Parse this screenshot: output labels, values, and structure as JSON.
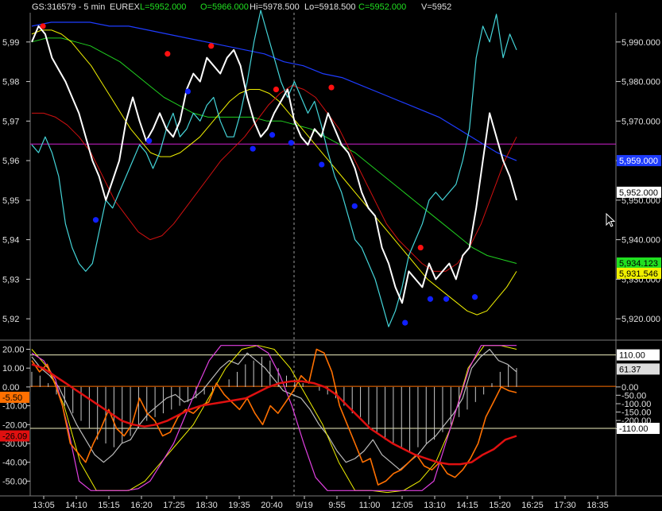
{
  "header": {
    "symbol": "GS:316579 - 5 min",
    "exchange": "EUREX",
    "last": "L=5952.000",
    "open": "O=5966.000",
    "high": "Hi=5978.500",
    "low": "Lo=5918.500",
    "close": "C=5952.000",
    "volume": "V=5952"
  },
  "colors": {
    "price": "#ffffff",
    "cyan": "#44d4d8",
    "yellow": "#f0f000",
    "green": "#20d020",
    "blue": "#1e3cff",
    "darkred": "#d01010",
    "magenta": "#d020d0",
    "orange": "#ff7000",
    "osc_red": "#e01010",
    "grid": "#3a3a3a",
    "axis_text": "#e0e0e0"
  },
  "chart_data": [
    {
      "type": "line",
      "panel": "price",
      "title": "",
      "ylim": [
        5915,
        5997
      ],
      "right_ticks": [
        "5,990.000",
        "5,980.000",
        "5,970.000",
        "5,960.000",
        "5,950.000",
        "5,940.000",
        "5,930.000",
        "5,920.000"
      ],
      "right_tick_values": [
        5990,
        5980,
        5970,
        5960,
        5950,
        5940,
        5930,
        5920
      ],
      "left_ticks": [
        "5,99",
        "5,98",
        "5,97",
        "5,96",
        "5,95",
        "5,94",
        "5,93",
        "5,92"
      ],
      "left_tick_values": [
        5990,
        5980,
        5970,
        5960,
        5950,
        5940,
        5930,
        5920
      ],
      "badges": [
        {
          "text": "5,952.000",
          "value": 5952,
          "bg": "#ffffff",
          "fg": "#000000"
        },
        {
          "text": "5,959.000",
          "value": 5960,
          "bg": "#1e3cff",
          "fg": "#ffffff"
        },
        {
          "text": "5,934.123",
          "value": 5934.1,
          "bg": "#20e020",
          "fg": "#000000"
        },
        {
          "text": "5,931.546",
          "value": 5931.5,
          "bg": "#f0f000",
          "fg": "#000000"
        }
      ],
      "hline": {
        "value": 5964.2,
        "color": "#d020d0"
      },
      "series": [
        {
          "color": "#ffffff",
          "width": 2,
          "values": [
            5990,
            5994,
            5992,
            5986,
            5983,
            5980,
            5976,
            5972,
            5966,
            5960,
            5956,
            5950,
            5955,
            5960,
            5970,
            5976,
            5970,
            5965,
            5968,
            5972,
            5968,
            5966,
            5970,
            5978,
            5982,
            5980,
            5986,
            5984,
            5982,
            5986,
            5988,
            5984,
            5976,
            5970,
            5966,
            5968,
            5972,
            5975,
            5978,
            5970,
            5966,
            5964,
            5968,
            5966,
            5972,
            5968,
            5964,
            5962,
            5958,
            5952,
            5948,
            5946,
            5938,
            5934,
            5928,
            5924,
            5932,
            5930,
            5928,
            5934,
            5930,
            5932,
            5934,
            5930,
            5936,
            5938,
            5948,
            5960,
            5972,
            5966,
            5960,
            5956,
            5950
          ]
        },
        {
          "color": "#44d4d8",
          "width": 1.2,
          "values": [
            5964,
            5962,
            5966,
            5962,
            5956,
            5944,
            5938,
            5934,
            5932,
            5934,
            5942,
            5950,
            5948,
            5952,
            5956,
            5960,
            5964,
            5962,
            5958,
            5962,
            5968,
            5972,
            5966,
            5968,
            5972,
            5970,
            5974,
            5976,
            5970,
            5966,
            5966,
            5972,
            5980,
            5990,
            5998,
            5992,
            5986,
            5980,
            5976,
            5980,
            5976,
            5972,
            5975,
            5969,
            5962,
            5956,
            5952,
            5946,
            5940,
            5938,
            5934,
            5930,
            5924,
            5918,
            5922,
            5928,
            5936,
            5940,
            5944,
            5950,
            5952,
            5950,
            5952,
            5954,
            5960,
            5968,
            5986,
            5994,
            5990,
            5997,
            5986,
            5992,
            5988
          ]
        },
        {
          "color": "#f0f000",
          "width": 1,
          "values": [
            5992,
            5993,
            5993,
            5992,
            5990,
            5987,
            5984,
            5980,
            5976,
            5972,
            5968,
            5965,
            5962,
            5961,
            5961,
            5962,
            5964,
            5966,
            5969,
            5972,
            5975,
            5977,
            5978,
            5978,
            5977,
            5975,
            5972,
            5969,
            5966,
            5963,
            5960,
            5957,
            5954,
            5951,
            5948,
            5945,
            5942,
            5939,
            5936,
            5933,
            5930,
            5928,
            5926,
            5924,
            5922,
            5921,
            5922,
            5925,
            5928,
            5932
          ]
        },
        {
          "color": "#20d020",
          "width": 1,
          "values": [
            5990,
            5991,
            5991,
            5990,
            5989,
            5987,
            5985,
            5982,
            5979,
            5976,
            5974,
            5972,
            5971,
            5971,
            5971,
            5971,
            5970,
            5970,
            5969,
            5968,
            5966,
            5964,
            5962,
            5959,
            5956,
            5953,
            5950,
            5947,
            5944,
            5941,
            5938,
            5936,
            5935,
            5934
          ]
        },
        {
          "color": "#1e3cff",
          "width": 1.2,
          "values": [
            5994,
            5995,
            5995,
            5995,
            5994,
            5994,
            5993,
            5992,
            5991,
            5990,
            5989,
            5988,
            5987,
            5985,
            5984,
            5982,
            5981,
            5979,
            5977,
            5975,
            5973,
            5971,
            5968,
            5965,
            5962,
            5960
          ]
        },
        {
          "color": "#d01010",
          "width": 1,
          "values": [
            5972,
            5972,
            5971,
            5969,
            5966,
            5962,
            5956,
            5950,
            5946,
            5942,
            5940,
            5941,
            5944,
            5948,
            5952,
            5956,
            5960,
            5963,
            5966,
            5970,
            5974,
            5977,
            5979,
            5978,
            5976,
            5972,
            5968,
            5962,
            5956,
            5950,
            5944,
            5940,
            5937,
            5934,
            5932,
            5932,
            5934,
            5938,
            5944,
            5952,
            5960,
            5966
          ]
        }
      ],
      "points": [
        {
          "color": "red",
          "x": 0.023,
          "value": 5994
        },
        {
          "color": "red",
          "x": 0.28,
          "value": 5987
        },
        {
          "color": "red",
          "x": 0.37,
          "value": 5989
        },
        {
          "color": "red",
          "x": 0.504,
          "value": 5978
        },
        {
          "color": "red",
          "x": 0.618,
          "value": 5978.5
        },
        {
          "color": "red",
          "x": 0.802,
          "value": 5938
        },
        {
          "color": "blue",
          "x": 0.132,
          "value": 5945
        },
        {
          "color": "blue",
          "x": 0.242,
          "value": 5965
        },
        {
          "color": "blue",
          "x": 0.322,
          "value": 5977.5
        },
        {
          "color": "blue",
          "x": 0.456,
          "value": 5963
        },
        {
          "color": "blue",
          "x": 0.496,
          "value": 5966.5
        },
        {
          "color": "blue",
          "x": 0.535,
          "value": 5964.5
        },
        {
          "color": "blue",
          "x": 0.598,
          "value": 5959
        },
        {
          "color": "blue",
          "x": 0.666,
          "value": 5948.5
        },
        {
          "color": "blue",
          "x": 0.77,
          "value": 5919
        },
        {
          "color": "blue",
          "x": 0.822,
          "value": 5925
        },
        {
          "color": "blue",
          "x": 0.855,
          "value": 5925
        },
        {
          "color": "blue",
          "x": 0.914,
          "value": 5925.5
        }
      ]
    },
    {
      "type": "line",
      "panel": "oscillator",
      "title": "",
      "ylim": [
        -57,
        24
      ],
      "left_ticks": [
        "20.00",
        "10.00",
        "0.00",
        "-10.00",
        "-20.00",
        "-30.00",
        "-40.00",
        "-50.00"
      ],
      "left_tick_values": [
        20,
        10,
        0,
        -10,
        -20,
        -30,
        -40,
        -50
      ],
      "right_ticks": [
        "0.00",
        "-50.00",
        "-100.00",
        "-150.00",
        "-200.00",
        "-250.00"
      ],
      "right_tick_values": [
        0,
        -4.4,
        -8.9,
        -13.3,
        -17.8,
        -22.2
      ],
      "left_badges": [
        {
          "text": "-5.50",
          "value": -5.5,
          "bg": "#ff7000",
          "fg": "#000000"
        },
        {
          "text": "-26.09",
          "value": -26,
          "bg": "#e01010",
          "fg": "#000000"
        }
      ],
      "right_badges": [
        {
          "text": "110.00",
          "value": 17,
          "bg": "#ffffff",
          "fg": "#000000"
        },
        {
          "text": "61.37",
          "value": 9.5,
          "bg": "#dddddd",
          "fg": "#000000"
        },
        {
          "text": "-110.00",
          "value": -22,
          "bg": "#ffffff",
          "fg": "#000000"
        }
      ],
      "hlines": [
        {
          "value": 17,
          "color": "#f0f0c0"
        },
        {
          "value": 0.3,
          "color": "#ff7000"
        },
        {
          "value": -22,
          "color": "#f0f0c0"
        }
      ],
      "histogram": [
        8,
        6,
        2,
        -4,
        -10,
        -14,
        -18,
        -22,
        -28,
        -30,
        -32,
        -30,
        -26,
        -22,
        -18,
        -16,
        -14,
        -12,
        -10,
        -8,
        -6,
        -4,
        -2,
        0,
        4,
        8,
        12,
        14,
        16,
        14,
        10,
        6,
        4,
        2,
        0,
        -2,
        -4,
        -6,
        -10,
        -14,
        -16,
        -20,
        -24,
        -28,
        -30,
        -32,
        -34,
        -32,
        -30,
        -28,
        -24,
        -20,
        -16,
        -12,
        -8,
        -4,
        2,
        8,
        12,
        10
      ],
      "series": [
        {
          "color": "#e01010",
          "width": 2.5,
          "values": [
            12,
            10,
            6,
            2,
            -2,
            -6,
            -10,
            -14,
            -18,
            -20,
            -21,
            -20,
            -18,
            -15,
            -12,
            -10,
            -9,
            -8,
            -7,
            -6,
            -3,
            0,
            2,
            3,
            3,
            2,
            0,
            -4,
            -10,
            -16,
            -22,
            -26,
            -30,
            -33,
            -36,
            -38,
            -40,
            -41,
            -41,
            -40,
            -36,
            -33,
            -28,
            -26
          ]
        },
        {
          "color": "#ff7000",
          "width": 1.6,
          "values": [
            14,
            8,
            12,
            2,
            -10,
            -30,
            -35,
            -40,
            -30,
            -22,
            -12,
            -22,
            -26,
            -20,
            -6,
            -14,
            -18,
            -26,
            -24,
            -16,
            -12,
            -14,
            -10,
            -8,
            2,
            -4,
            -8,
            -12,
            -6,
            -14,
            -20,
            -10,
            -14,
            -8,
            -2,
            6,
            2,
            20,
            18,
            8,
            -10,
            -20,
            -30,
            -40,
            -38,
            -52,
            -50,
            -46,
            -44,
            -40,
            -36,
            -42,
            -44,
            -40,
            -46,
            -48,
            -44,
            -38,
            -30,
            -16,
            -8,
            0,
            -2,
            -3
          ]
        },
        {
          "color": "#bbbbbb",
          "width": 1.2,
          "values": [
            16,
            10,
            6,
            0,
            -10,
            -20,
            -28,
            -36,
            -40,
            -36,
            -30,
            -28,
            -20,
            -14,
            -10,
            -6,
            -4,
            -8,
            -6,
            -2,
            4,
            10,
            14,
            12,
            18,
            14,
            10,
            4,
            -2,
            -4,
            -6,
            -12,
            -20,
            -26,
            -34,
            -40,
            -38,
            -34,
            -28,
            -36,
            -40,
            -44,
            -40,
            -36,
            -30,
            -26,
            -20,
            -14,
            -6,
            10,
            16,
            20,
            14,
            12,
            8
          ]
        },
        {
          "color": "#e040e0",
          "width": 1.2,
          "values": [
            18,
            14,
            4,
            -20,
            -50,
            -55,
            -55,
            -55,
            -55,
            -54,
            -50,
            -40,
            -30,
            -15,
            0,
            14,
            22,
            22,
            22,
            22,
            18,
            6,
            -10,
            -30,
            -48,
            -55,
            -55,
            -55,
            -55,
            -55,
            -55,
            -55,
            -55,
            -55,
            -50,
            -30,
            -10,
            10,
            22,
            22,
            22,
            22
          ]
        },
        {
          "color": "#f0f000",
          "width": 1,
          "values": [
            20,
            10,
            -10,
            -40,
            -55,
            -55,
            -55,
            -50,
            -40,
            -30,
            -20,
            -5,
            10,
            20,
            22,
            20,
            10,
            -5,
            -20,
            -40,
            -55,
            -55,
            -56,
            -55,
            -50,
            -40,
            -20,
            10,
            22,
            22,
            20
          ]
        }
      ],
      "time_labels": [
        "13:05",
        "14:10",
        "15:15",
        "16:20",
        "17:25",
        "18:30",
        "19:35",
        "20:40",
        "9/19",
        "9:55",
        "11:00",
        "12:05",
        "13:10",
        "14:15",
        "15:20",
        "16:25",
        "17:30",
        "18:35"
      ]
    }
  ]
}
